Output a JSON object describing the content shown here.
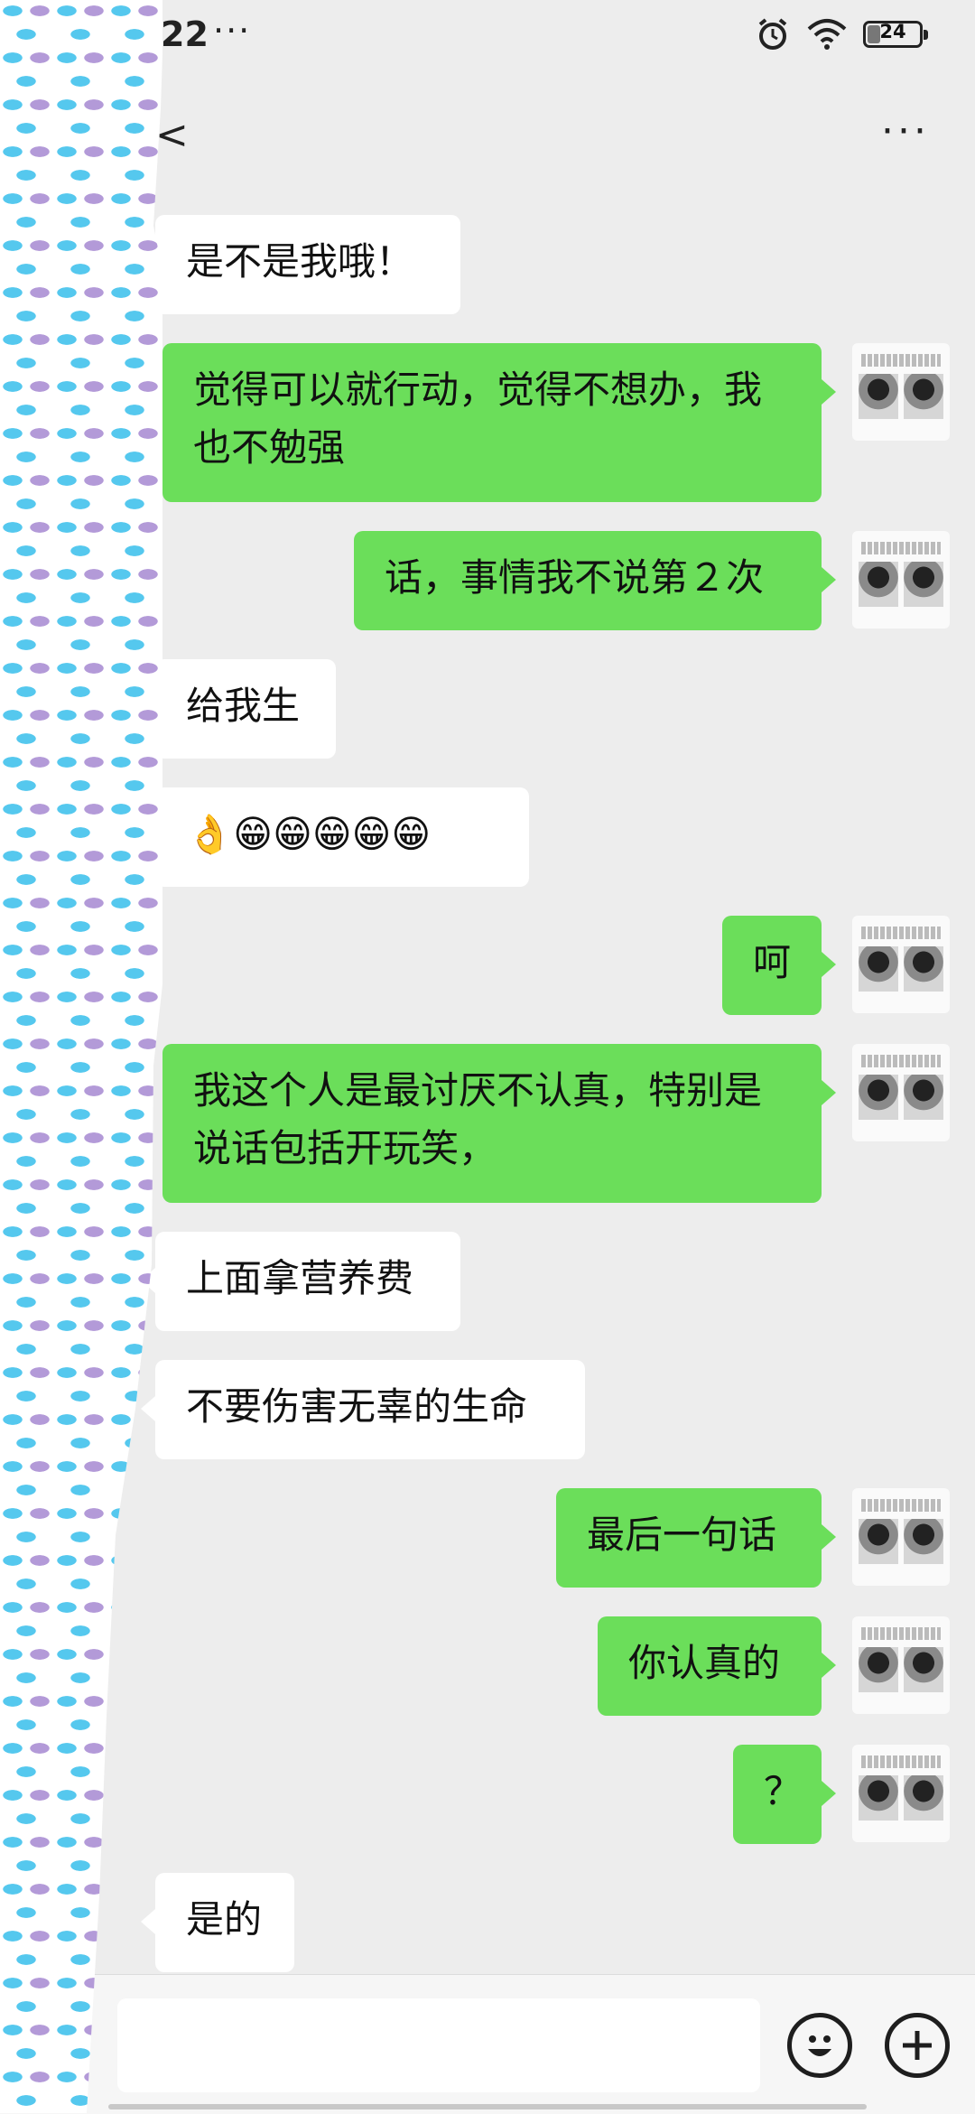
{
  "status_bar": {
    "time": "22",
    "more": "···",
    "battery": "24"
  },
  "header": {
    "back_glyph": "<",
    "more": "···"
  },
  "messages": [
    {
      "dir": "in",
      "text": "是不是我哦！"
    },
    {
      "dir": "out",
      "text": "觉得可以就行动，觉得不想办，我也不勉强"
    },
    {
      "dir": "out",
      "text": "话，事情我不说第２次"
    },
    {
      "dir": "in",
      "text": "给我生"
    },
    {
      "dir": "in",
      "text": "👌😁😁😁😁😁"
    },
    {
      "dir": "out",
      "text": "呵"
    },
    {
      "dir": "out",
      "text": "我这个人是最讨厌不认真，特别是说话包括开玩笑，"
    },
    {
      "dir": "in",
      "text": "上面拿营养费"
    },
    {
      "dir": "in",
      "text": "不要伤害无辜的生命"
    },
    {
      "dir": "out",
      "text": "最后一句话"
    },
    {
      "dir": "out",
      "text": "你认真的"
    },
    {
      "dir": "out",
      "text": "？"
    },
    {
      "dir": "in",
      "text": "是的"
    }
  ],
  "input": {
    "value": ""
  },
  "icons": {
    "emoji": "smile-icon",
    "plus": "plus-icon",
    "alarm": "alarm-icon",
    "wifi": "wifi-icon"
  },
  "colors": {
    "outgoing_bubble": "#6bde5a",
    "incoming_bubble": "#ffffff",
    "background": "#ededed"
  }
}
